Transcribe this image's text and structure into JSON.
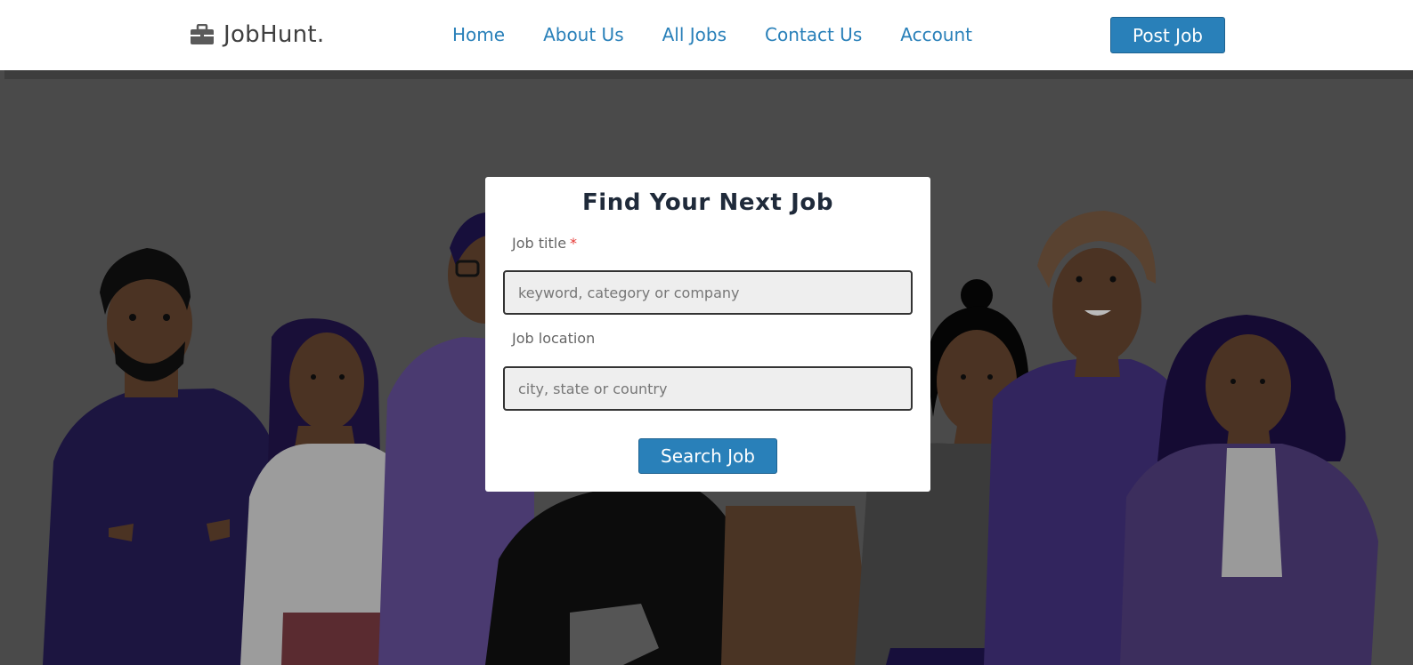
{
  "brand": {
    "name": "JobHunt.",
    "icon": "briefcase-icon"
  },
  "nav": {
    "links": [
      {
        "label": "Home"
      },
      {
        "label": "About Us"
      },
      {
        "label": "All Jobs"
      },
      {
        "label": "Contact Us"
      },
      {
        "label": "Account"
      }
    ],
    "post_job_label": "Post Job"
  },
  "search_card": {
    "title": "Find Your Next Job",
    "job_title_label": "Job title",
    "required_marker": "*",
    "job_title_placeholder": "keyword, category or company",
    "job_title_value": "",
    "location_label": "Job location",
    "location_placeholder": "city, state or country",
    "location_value": "",
    "search_button_label": "Search Job"
  },
  "colors": {
    "accent": "#2980b9",
    "overlay": "#4a4a4a",
    "required": "#e53935"
  }
}
